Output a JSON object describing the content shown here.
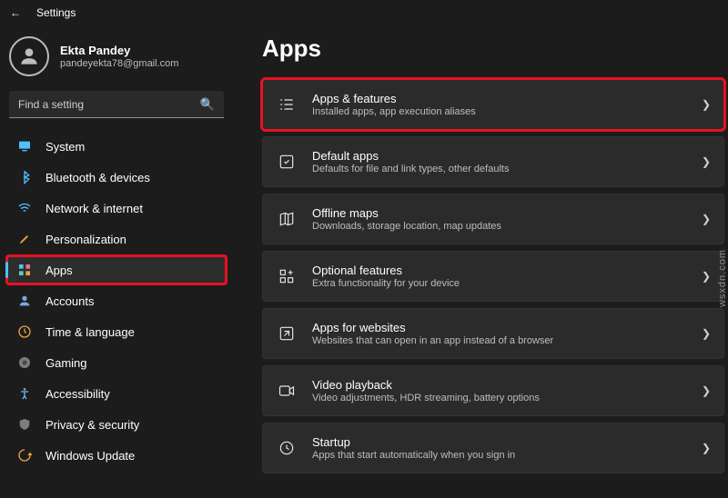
{
  "window": {
    "title": "Settings"
  },
  "profile": {
    "name": "Ekta Pandey",
    "email": "pandeyekta78@gmail.com"
  },
  "search": {
    "placeholder": "Find a setting"
  },
  "nav": [
    {
      "label": "System"
    },
    {
      "label": "Bluetooth & devices"
    },
    {
      "label": "Network & internet"
    },
    {
      "label": "Personalization"
    },
    {
      "label": "Apps"
    },
    {
      "label": "Accounts"
    },
    {
      "label": "Time & language"
    },
    {
      "label": "Gaming"
    },
    {
      "label": "Accessibility"
    },
    {
      "label": "Privacy & security"
    },
    {
      "label": "Windows Update"
    }
  ],
  "page": {
    "title": "Apps"
  },
  "cards": [
    {
      "title": "Apps & features",
      "sub": "Installed apps, app execution aliases"
    },
    {
      "title": "Default apps",
      "sub": "Defaults for file and link types, other defaults"
    },
    {
      "title": "Offline maps",
      "sub": "Downloads, storage location, map updates"
    },
    {
      "title": "Optional features",
      "sub": "Extra functionality for your device"
    },
    {
      "title": "Apps for websites",
      "sub": "Websites that can open in an app instead of a browser"
    },
    {
      "title": "Video playback",
      "sub": "Video adjustments, HDR streaming, battery options"
    },
    {
      "title": "Startup",
      "sub": "Apps that start automatically when you sign in"
    }
  ],
  "watermark": "wsxdn.com"
}
